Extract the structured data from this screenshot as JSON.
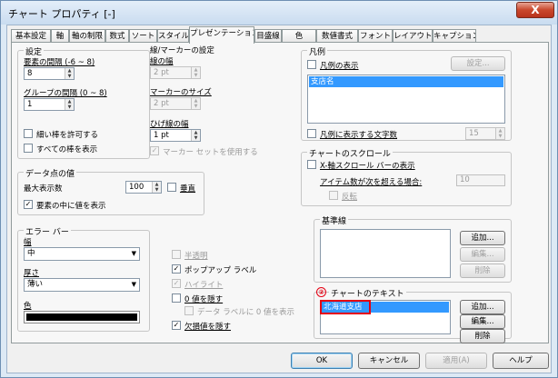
{
  "window": {
    "title": "チャート プロパティ [-]",
    "close_glyph": "X"
  },
  "tabs": [
    "基本設定",
    "軸",
    "軸の制限",
    "数式",
    "ソート",
    "スタイル",
    "プレゼンテーション",
    "目盛線",
    "色",
    "数値書式",
    "フォント",
    "レイアウト",
    "キャプション"
  ],
  "settings": {
    "title": "設定",
    "element_spacing_label": "要素の間隔 (-6 ~ 8)",
    "element_spacing_value": "8",
    "group_spacing_label": "グループの間隔 (0 ~ 8)",
    "group_spacing_value": "1",
    "allow_thin_bars": "細い棒を許可する",
    "show_all_bars": "すべての棒を表示"
  },
  "line_marker": {
    "title": "線/マーカーの設定",
    "line_width_label": "線の幅",
    "line_width_value": "2 pt",
    "marker_size_label": "マーカーのサイズ",
    "marker_size_value": "2 pt",
    "whisker_width_label": "ひげ線の幅",
    "whisker_width_value": "1 pt",
    "use_marker_set": "マーカー セットを使用する"
  },
  "data_values": {
    "title": "データ点の値",
    "max_count_label": "最大表示数",
    "max_count_value": "100",
    "vertical_label": "垂直",
    "inside_label": "要素の中に値を表示"
  },
  "error_bar": {
    "title": "エラー バー",
    "width_label": "幅",
    "width_value": "中",
    "thickness_label": "厚さ",
    "thickness_value": "薄い",
    "color_label": "色",
    "color_value": "#000000"
  },
  "misc": {
    "semi_transparent": "半透明",
    "popup_label": "ポップアップ ラベル",
    "highlight": "ハイライト",
    "hide_zero": "0 値を隠す",
    "show_zero_on_label": "データ ラベルに 0 値を表示",
    "hide_missing": "欠損値を隠す"
  },
  "legend": {
    "title": "凡例",
    "show_legend": "凡例の表示",
    "settings_button": "設定...",
    "items": [
      "支店名"
    ],
    "char_limit_label": "凡例に表示する文字数",
    "char_limit_value": "15"
  },
  "scroll": {
    "title": "チャートのスクロール",
    "x_scroll_label": "X-軸スクロール バーの表示",
    "items_exceed_label": "アイテム数が次を超える場合:",
    "items_exceed_value": "10",
    "reverse_label": "反転"
  },
  "reference_lines": {
    "title": "基準線",
    "add_button": "追加...",
    "edit_button": "編集...",
    "delete_button": "削除"
  },
  "chart_text": {
    "title": "チャートのテキスト",
    "marker": "②",
    "items": [
      "北海道支店"
    ],
    "add_button": "追加...",
    "edit_button": "編集...",
    "delete_button": "削除"
  },
  "footer": {
    "ok": "OK",
    "cancel": "キャンセル",
    "apply": "適用(A)",
    "help": "ヘルプ"
  }
}
